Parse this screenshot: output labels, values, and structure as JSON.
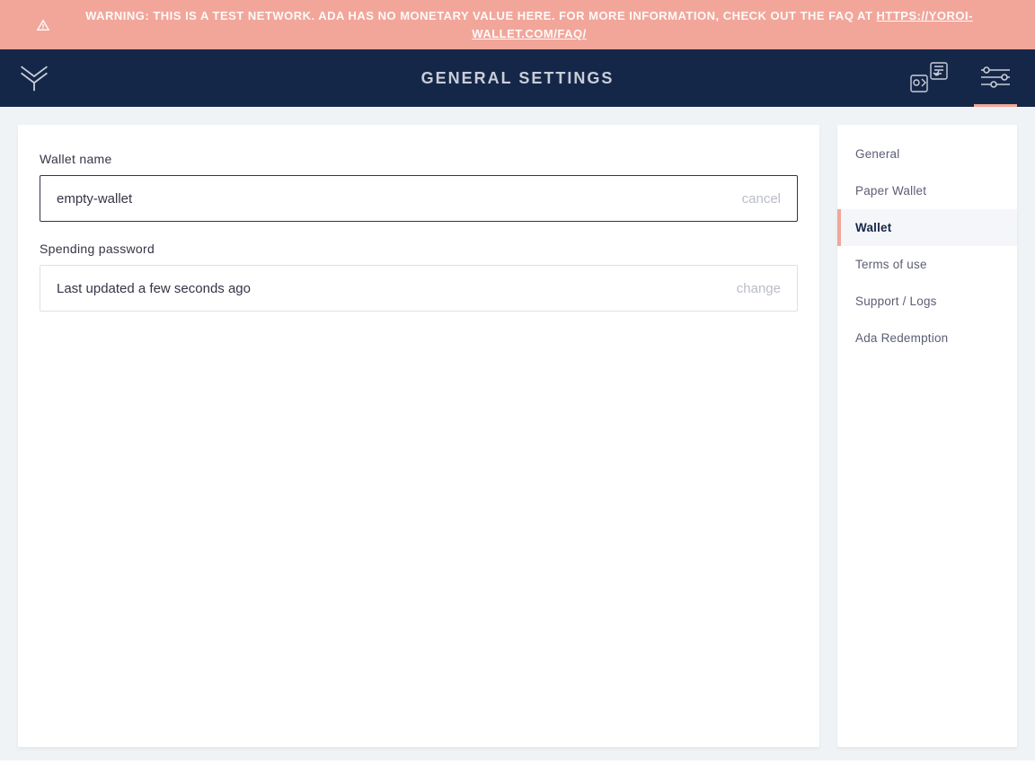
{
  "banner": {
    "prefix": "WARNING: THIS IS A TEST NETWORK. ADA HAS NO MONETARY VALUE HERE. FOR MORE INFORMATION, CHECK OUT THE FAQ AT ",
    "link_text": "HTTPS://YOROI-WALLET.COM/FAQ/"
  },
  "header": {
    "title": "GENERAL SETTINGS"
  },
  "main": {
    "wallet_name_label": "Wallet name",
    "wallet_name_value": "empty-wallet",
    "wallet_name_action": "cancel",
    "spending_password_label": "Spending password",
    "spending_password_value": "Last updated a few seconds ago",
    "spending_password_action": "change"
  },
  "sidebar": {
    "items": [
      {
        "label": "General",
        "active": false
      },
      {
        "label": "Paper Wallet",
        "active": false
      },
      {
        "label": "Wallet",
        "active": true
      },
      {
        "label": "Terms of use",
        "active": false
      },
      {
        "label": "Support / Logs",
        "active": false
      },
      {
        "label": "Ada Redemption",
        "active": false
      }
    ]
  },
  "colors": {
    "accent": "#F2A69A",
    "header_bg": "#152749"
  }
}
